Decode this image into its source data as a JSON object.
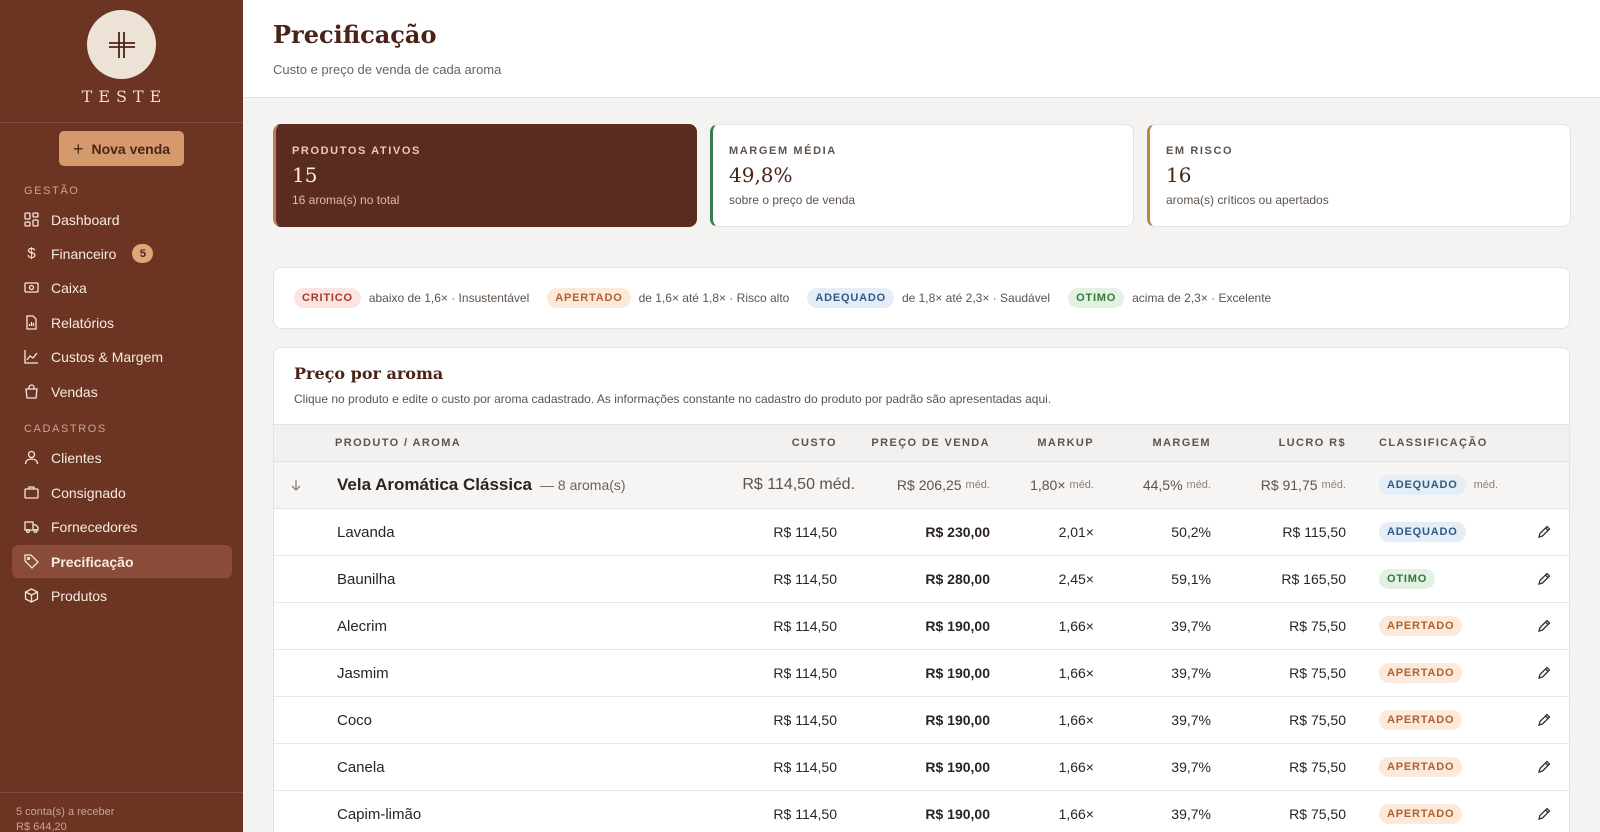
{
  "brand": {
    "name": "TESTE"
  },
  "actions": {
    "new_sale": "Nova venda"
  },
  "nav": {
    "section_gestao": "GESTÃO",
    "section_cadastros": "CADASTROS",
    "items": [
      {
        "label": "Dashboard",
        "icon": "dashboard-icon"
      },
      {
        "label": "Financeiro",
        "icon": "dollar-icon",
        "badge": "5"
      },
      {
        "label": "Caixa",
        "icon": "cash-register-icon"
      },
      {
        "label": "Relatórios",
        "icon": "report-icon"
      },
      {
        "label": "Custos & Margem",
        "icon": "line-chart-icon"
      },
      {
        "label": "Vendas",
        "icon": "shopping-bag-icon"
      },
      {
        "label": "Clientes",
        "icon": "user-icon"
      },
      {
        "label": "Consignado",
        "icon": "briefcase-icon"
      },
      {
        "label": "Fornecedores",
        "icon": "truck-icon"
      },
      {
        "label": "Precificação",
        "icon": "tag-icon",
        "active": true
      },
      {
        "label": "Produtos",
        "icon": "box-icon"
      }
    ]
  },
  "footer": {
    "receivables": "5 conta(s) a receber",
    "amount": "R$ 644,20"
  },
  "header": {
    "title": "Precificação",
    "subtitle": "Custo e preço de venda de cada aroma"
  },
  "stats": [
    {
      "label": "PRODUTOS ATIVOS",
      "value": "15",
      "sub": "16 aroma(s) no total"
    },
    {
      "label": "MARGEM MÉDIA",
      "value": "49,8%",
      "sub": "sobre o preço de venda"
    },
    {
      "label": "EM RISCO",
      "value": "16",
      "sub": "aroma(s) críticos ou apertados"
    }
  ],
  "legend": [
    {
      "tag": "CRITICO",
      "desc": "abaixo de 1,6× · Insustentável"
    },
    {
      "tag": "APERTADO",
      "desc": "de 1,6× até 1,8× · Risco alto"
    },
    {
      "tag": "ADEQUADO",
      "desc": "de 1,8× até 2,3× · Saudável"
    },
    {
      "tag": "OTIMO",
      "desc": "acima de 2,3× · Excelente"
    }
  ],
  "table": {
    "title": "Preço por aroma",
    "subtitle": "Clique no produto e edite o custo por aroma cadastrado. As informações constante no cadastro do produto por padrão são apresentadas aqui.",
    "headers": {
      "product": "PRODUTO / AROMA",
      "cost": "CUSTO",
      "price": "PREÇO DE VENDA",
      "markup": "MARKUP",
      "margin": "MARGEM",
      "profit": "LUCRO R$",
      "class": "CLASSIFICAÇÃO"
    },
    "group": {
      "name": "Vela Aromática Clássica",
      "count": "— 8 aroma(s)",
      "cost": "R$ 114,50 méd.",
      "price": "R$ 206,25",
      "markup": "1,80×",
      "margin": "44,5%",
      "profit": "R$ 91,75",
      "class": "ADEQUADO",
      "med": "méd."
    },
    "rows": [
      {
        "name": "Lavanda",
        "cost": "R$ 114,50",
        "price": "R$ 230,00",
        "markup": "2,01×",
        "margin": "50,2%",
        "profit": "R$ 115,50",
        "class": "ADEQUADO"
      },
      {
        "name": "Baunilha",
        "cost": "R$ 114,50",
        "price": "R$ 280,00",
        "markup": "2,45×",
        "margin": "59,1%",
        "profit": "R$ 165,50",
        "class": "OTIMO"
      },
      {
        "name": "Alecrim",
        "cost": "R$ 114,50",
        "price": "R$ 190,00",
        "markup": "1,66×",
        "margin": "39,7%",
        "profit": "R$ 75,50",
        "class": "APERTADO"
      },
      {
        "name": "Jasmim",
        "cost": "R$ 114,50",
        "price": "R$ 190,00",
        "markup": "1,66×",
        "margin": "39,7%",
        "profit": "R$ 75,50",
        "class": "APERTADO"
      },
      {
        "name": "Coco",
        "cost": "R$ 114,50",
        "price": "R$ 190,00",
        "markup": "1,66×",
        "margin": "39,7%",
        "profit": "R$ 75,50",
        "class": "APERTADO"
      },
      {
        "name": "Canela",
        "cost": "R$ 114,50",
        "price": "R$ 190,00",
        "markup": "1,66×",
        "margin": "39,7%",
        "profit": "R$ 75,50",
        "class": "APERTADO"
      },
      {
        "name": "Capim-limão",
        "cost": "R$ 114,50",
        "price": "R$ 190,00",
        "markup": "1,66×",
        "margin": "39,7%",
        "profit": "R$ 75,50",
        "class": "APERTADO"
      }
    ]
  },
  "colors": {
    "sidebar": "#6b3423",
    "accent": "#d59a6b",
    "title": "#4a2218"
  }
}
